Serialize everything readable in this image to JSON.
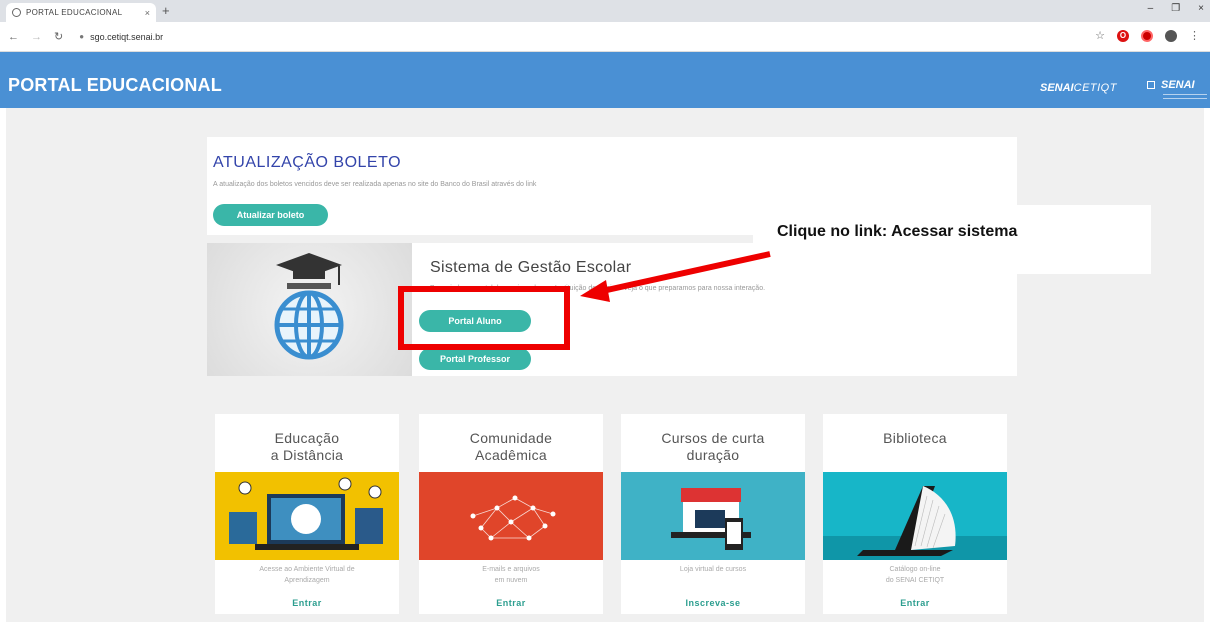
{
  "browser": {
    "tab_title": "PORTAL EDUCACIONAL",
    "tab_close": "×",
    "new_tab": "+",
    "url": "sgo.cetiqt.senai.br",
    "minimize": "–",
    "maximize": "❐",
    "close": "×"
  },
  "header": {
    "title": "PORTAL EDUCACIONAL",
    "logo_senai_bold": "SENAI",
    "logo_senai_light": "CETIQT",
    "logo_senai2": "SENAI"
  },
  "boleto": {
    "title": "ATUALIZAÇÃO BOLETO",
    "text": "A atualização dos boletos vencidos deve ser realizada apenas no site do Banco do Brasil através do link",
    "button": "Atualizar boleto"
  },
  "sge": {
    "title": "Sistema de Gestão Escolar",
    "text": "Bem-vindo ao portal de serviços da sua Instituição de Ensino. Veja o que preparamos para nossa interação.",
    "btn_aluno": "Portal Aluno",
    "btn_professor": "Portal Professor"
  },
  "callout": "Clique no link: Acessar sistema",
  "services": [
    {
      "title1": "Educação",
      "title2": "a Distância",
      "desc1": "Acesse ao Ambiente Virtual de",
      "desc2": "Aprendizagem",
      "link": "Entrar",
      "color": "#f2c100"
    },
    {
      "title1": "Comunidade",
      "title2": "Acadêmica",
      "desc1": "E-mails e arquivos",
      "desc2": "em nuvem",
      "link": "Entrar",
      "color": "#e0452a"
    },
    {
      "title1": "Cursos de curta",
      "title2": "duração",
      "desc1": "Loja virtual de cursos",
      "desc2": "",
      "link": "Inscreva-se",
      "color": "#3fb2c6"
    },
    {
      "title1": "Biblioteca",
      "title2": "",
      "desc1": "Catálogo on-line",
      "desc2": "do SENAI CETIQT",
      "link": "Entrar",
      "color": "#17b6c8"
    }
  ]
}
